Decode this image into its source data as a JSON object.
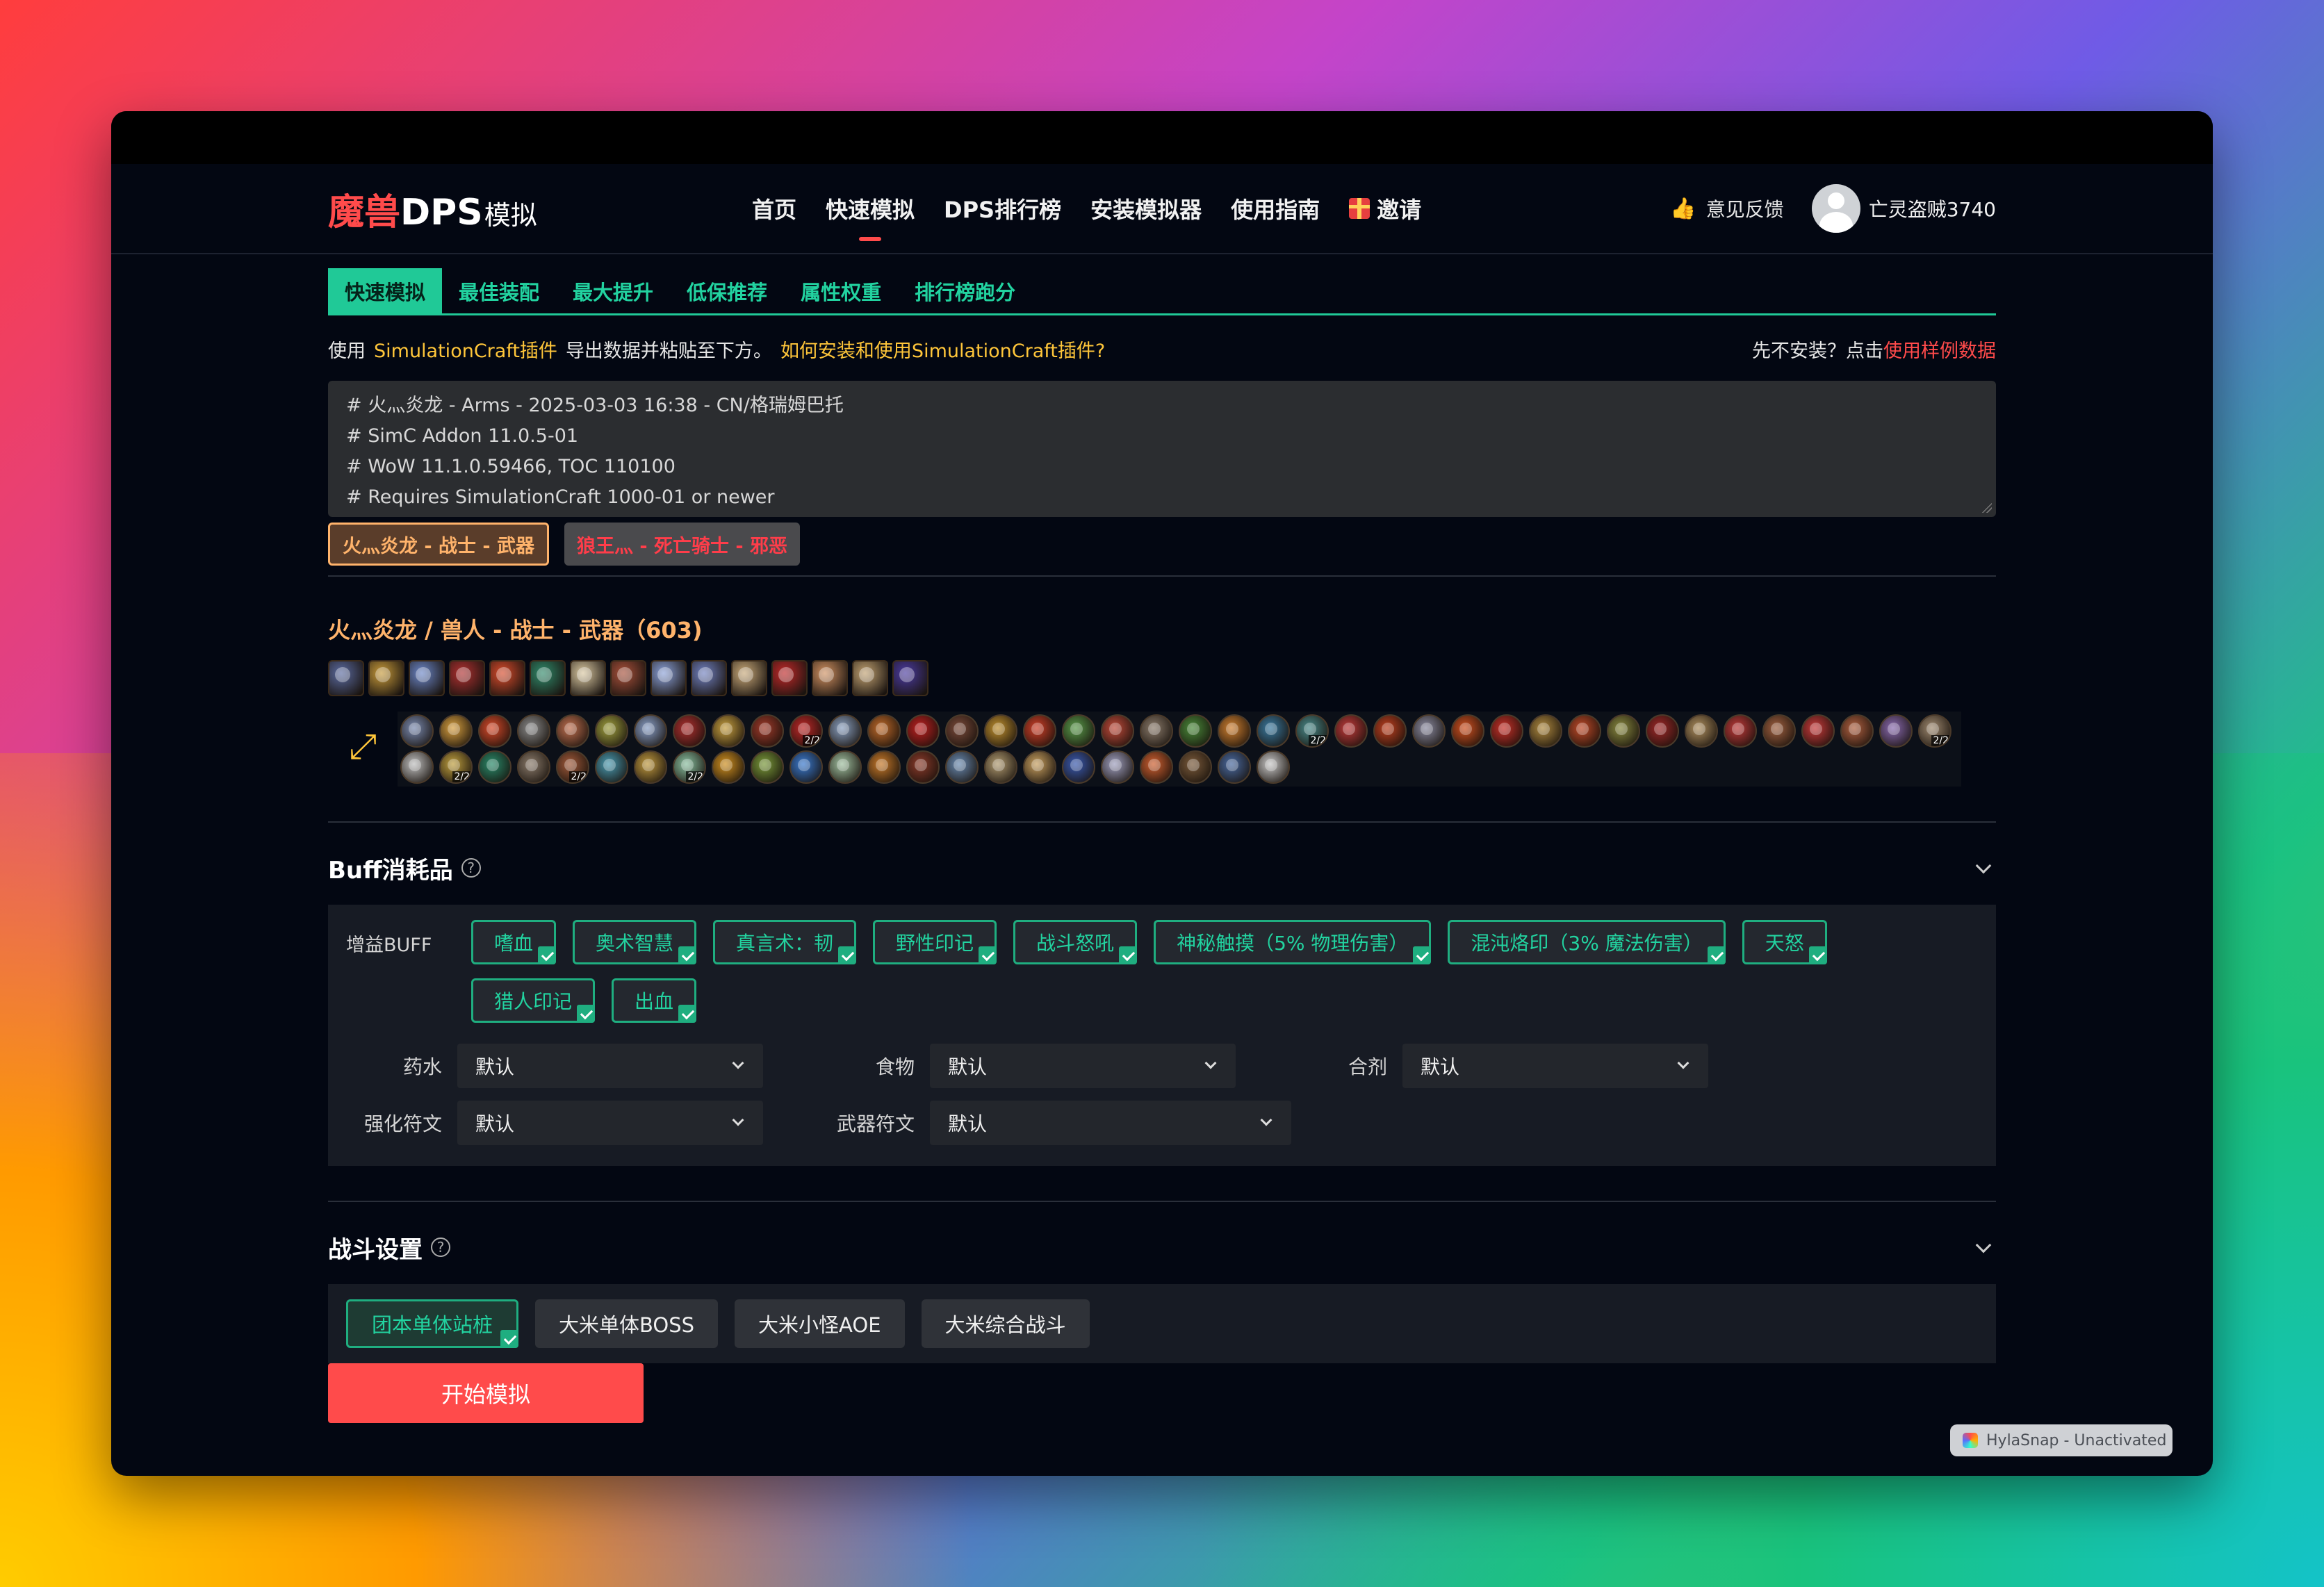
{
  "colors": {
    "accent_red": "#ff4b4b",
    "accent_green": "#20c997",
    "accent_gold": "#ffc63a",
    "char_orange": "#ffb36b"
  },
  "logo": {
    "part1": "魔兽",
    "part2": "DPS",
    "part3": "模拟"
  },
  "nav": {
    "items": [
      "首页",
      "快速模拟",
      "DPS排行榜",
      "安装模拟器",
      "使用指南",
      "邀请"
    ],
    "active": "快速模拟",
    "feedback": "意见反馈",
    "username": "亡灵盗贼3740"
  },
  "subtabs": {
    "items": [
      "快速模拟",
      "最佳装配",
      "最大提升",
      "低保推荐",
      "属性权重",
      "排行榜跑分"
    ],
    "active": "快速模拟"
  },
  "intro": {
    "prefix": "使用",
    "plugin_link": "SimulationCraft插件",
    "middle": "导出数据并粘贴至下方。",
    "howto_link": "如何安装和使用SimulationCraft插件?",
    "right_text": "先不安装？点击",
    "sample_link": "使用样例数据"
  },
  "simc_input": {
    "lines": [
      "# 火灬炎龙 - Arms - 2025-03-03 16:38 - CN/格瑞姆巴托",
      "# SimC Addon 11.0.5-01",
      "# WoW 11.1.0.59466, TOC 110100",
      "# Requires SimulationCraft 1000-01 or newer"
    ]
  },
  "characters": [
    {
      "label": "火灬炎龙 - 战士 - 武器",
      "selected": true
    },
    {
      "label": "狼王灬 - 死亡骑士 - 邪恶",
      "selected": false
    }
  ],
  "character_title": "火灬炎龙 / 兽人 - 战士 - 武器（603)",
  "gear_icons": [
    "head-icon",
    "neck-icon",
    "shoulder-icon",
    "back-icon",
    "chest-icon",
    "wrist-icon",
    "hands-icon",
    "waist-icon",
    "legs-icon",
    "feet-icon",
    "ring1-icon",
    "ring2-icon",
    "trinket1-icon",
    "trinket2-icon",
    "weapon-icon"
  ],
  "gear_colors": [
    "#5a6aa0",
    "#c79a3a",
    "#6b86c8",
    "#b03030",
    "#d84a2a",
    "#2f8a6a",
    "#d9c7a0",
    "#a8503a",
    "#8aa0d8",
    "#7080c0",
    "#c8a878",
    "#c02828",
    "#d09060",
    "#c0a070",
    "#4a3aa0"
  ],
  "talent_ranks": {
    "10": "2/2",
    "23": "2/2",
    "39": "2/2",
    "41": "2/2",
    "44": "2/2",
    "47": "2/2"
  },
  "talent_count": 63,
  "talent_colors": [
    "#7a8ab0",
    "#d8a040",
    "#d84a2a",
    "#8a8a8a",
    "#c07050",
    "#a0a040",
    "#8aa0c8",
    "#b03030",
    "#c8a040",
    "#a03a2a",
    "#c02828",
    "#8aa0c0",
    "#c06a2a",
    "#c02020",
    "#7a4a3a",
    "#c09030",
    "#d04028",
    "#5a9a4a",
    "#c04a3a",
    "#8a7a6a",
    "#4a8a3a",
    "#d08030",
    "#3a7aa0",
    "#4a8a8a",
    "#c03a3a",
    "#c04020",
    "#8a8aa0",
    "#d05020",
    "#c83028",
    "#b08a40",
    "#c04a28",
    "#8a8a40",
    "#a02828",
    "#b09060",
    "#c03a3a",
    "#a06040",
    "#c83a3a",
    "#b06040",
    "#8a6ab0",
    "#a08a70",
    "#c0c0c0",
    "#c0a040",
    "#2a8a6a",
    "#8a7a6a",
    "#a05a3a",
    "#4a9ab0",
    "#c09a40",
    "#8ac0a0",
    "#d09020",
    "#7a9a3a",
    "#3a7ad0",
    "#a0c0a0",
    "#c87a2a",
    "#8a3a2a",
    "#6a8ab0",
    "#b09a70",
    "#c8a060",
    "#3a5ab0",
    "#a0a0c0",
    "#d06030",
    "#7a5a3a",
    "#4a6aa0",
    "#c8c8c8"
  ],
  "buff_section": {
    "title": "Buff消耗品",
    "buff_label": "增益BUFF",
    "buffs": [
      "嗜血",
      "奥术智慧",
      "真言术：韧",
      "野性印记",
      "战斗怒吼",
      "神秘触摸（5% 物理伤害）",
      "混沌烙印（3% 魔法伤害）",
      "天怒",
      "猎人印记",
      "出血"
    ],
    "selects": [
      {
        "label": "药水",
        "value": "默认"
      },
      {
        "label": "食物",
        "value": "默认"
      },
      {
        "label": "合剂",
        "value": "默认"
      },
      {
        "label": "强化符文",
        "value": "默认"
      },
      {
        "label": "武器符文",
        "value": "默认"
      }
    ]
  },
  "battle_section": {
    "title": "战斗设置",
    "scenarios": [
      "团本单体站桩",
      "大米单体BOSS",
      "大米小怪AOE",
      "大米综合战斗"
    ],
    "active": "团本单体站桩"
  },
  "start_button": "开始模拟",
  "watermark": "HylaSnap - Unactivated"
}
